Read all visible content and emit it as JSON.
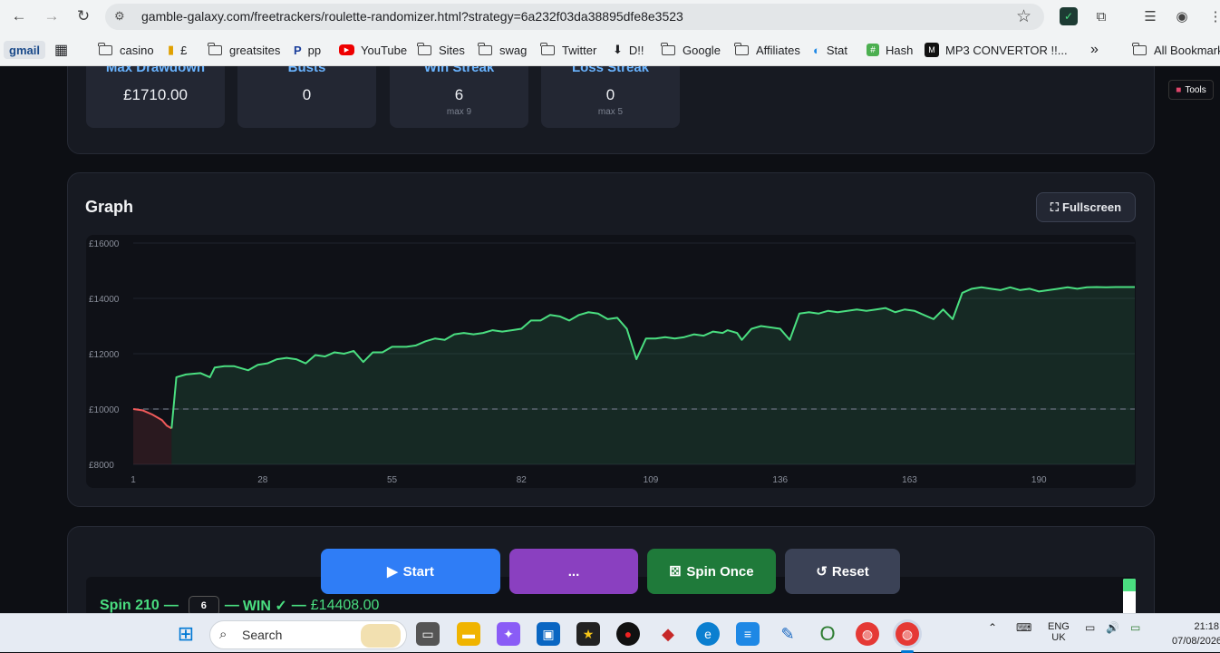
{
  "browser": {
    "url": "gamble-galaxy.com/freetrackers/roulette-randomizer.html?strategy=6a232f03da38895dfe8e3523",
    "bookmarks": [
      "gmail",
      "casino",
      "£",
      "greatsites",
      "pp",
      "YouTube",
      "Sites",
      "swag",
      "Twitter",
      "D!!",
      "Google",
      "Affiliates",
      "Stat",
      "Hash",
      "MP3 CONVERTOR !!..."
    ],
    "more": "»",
    "all_bookmarks": "All Bookmarks"
  },
  "stats": [
    {
      "title": "Max Drawdown",
      "value": "£1710.00",
      "sub": ""
    },
    {
      "title": "Busts",
      "value": "0",
      "sub": ""
    },
    {
      "title": "Win Streak",
      "value": "6",
      "sub": "max 9"
    },
    {
      "title": "Loss Streak",
      "value": "0",
      "sub": "max 5"
    }
  ],
  "graph": {
    "title": "Graph",
    "fullscreen_label": "Fullscreen"
  },
  "tools_label": "Tools",
  "controls": {
    "start": "Start",
    "more": "...",
    "spin_once": "Spin Once",
    "reset": "Reset"
  },
  "spin": {
    "label": "Spin 210",
    "sep1": "—",
    "number": "6",
    "sep2": "—",
    "result": "WIN ✓",
    "sep3": "—",
    "balance": "£14408.00"
  },
  "taskbar": {
    "search": "Search",
    "lang1": "ENG",
    "lang2": "UK",
    "time": "21:18",
    "date": "07/08/2026"
  },
  "chart_data": {
    "type": "line",
    "ylabels": [
      "£16000",
      "£14000",
      "£12000",
      "£10000",
      "£8000"
    ],
    "yticks": [
      16000,
      14000,
      12000,
      10000,
      8000
    ],
    "xticks": [
      1,
      28,
      55,
      82,
      109,
      136,
      163,
      190
    ],
    "ylim": [
      8000,
      16000
    ],
    "xlim": [
      1,
      210
    ],
    "baseline": 10000,
    "colors": {
      "line": "#4ade80",
      "negative": "#ef5a5a",
      "baseline": "#6b7280"
    },
    "series": [
      {
        "x": [
          1,
          3,
          5,
          7,
          8,
          9,
          10,
          12,
          15,
          17,
          18,
          20,
          22,
          25,
          27,
          29,
          31,
          33,
          35,
          37,
          39,
          41,
          43,
          45,
          47,
          49,
          51,
          53,
          55,
          57,
          58,
          60,
          62,
          64,
          66,
          68,
          70,
          72,
          74,
          76,
          78,
          80,
          82,
          84,
          86,
          88,
          90,
          92,
          94,
          96,
          98,
          100,
          102,
          104,
          106,
          108,
          110,
          112,
          114,
          116,
          118,
          120,
          122,
          124,
          125,
          126,
          127,
          128,
          130,
          132,
          134,
          136,
          138,
          140,
          142,
          144,
          146,
          148,
          150,
          152,
          154,
          156,
          158,
          160,
          162,
          164,
          166,
          168,
          170,
          172,
          174,
          176,
          178,
          180,
          182,
          184,
          186,
          188,
          190,
          192,
          194,
          196,
          198,
          200,
          202,
          204,
          206,
          208,
          210
        ],
        "y": [
          10000,
          9950,
          9800,
          9600,
          9400,
          9300,
          11150,
          11250,
          11300,
          11150,
          11500,
          11550,
          11550,
          11400,
          11600,
          11650,
          11800,
          11850,
          11800,
          11650,
          11950,
          11900,
          12050,
          12000,
          12100,
          11700,
          12050,
          12050,
          12250,
          12250,
          12250,
          12300,
          12450,
          12550,
          12500,
          12700,
          12750,
          12700,
          12750,
          12850,
          12800,
          12850,
          12900,
          13200,
          13200,
          13400,
          13350,
          13200,
          13400,
          13500,
          13450,
          13250,
          13300,
          12900,
          11800,
          12550,
          12550,
          12600,
          12550,
          12600,
          12700,
          12650,
          12800,
          12750,
          12850,
          12800,
          12750,
          12500,
          12900,
          13000,
          12950,
          12900,
          12500,
          13450,
          13500,
          13450,
          13550,
          13500,
          13550,
          13600,
          13550,
          13600,
          13650,
          13500,
          13600,
          13550,
          13400,
          13250,
          13600,
          13250,
          14200,
          14350,
          14400,
          14350,
          14300,
          14400,
          14300,
          14350,
          14250,
          14300,
          14350,
          14400,
          14350,
          14400,
          14408,
          14400,
          14410,
          14408,
          14408
        ]
      }
    ]
  }
}
